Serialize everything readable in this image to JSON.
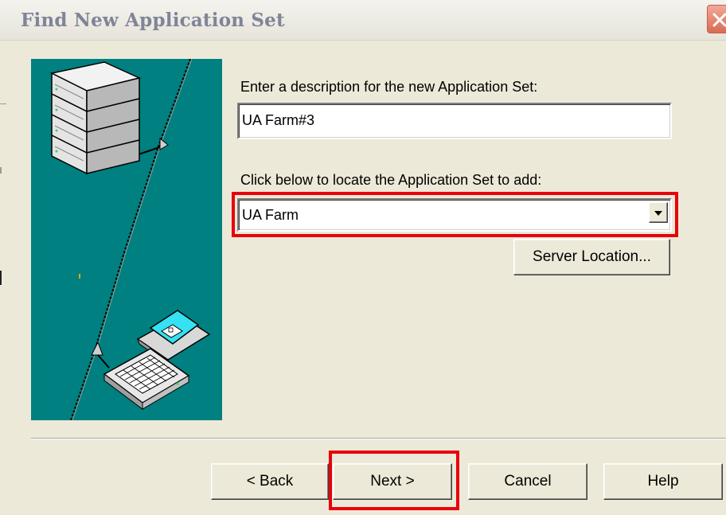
{
  "window": {
    "title": "Find New Application Set"
  },
  "form": {
    "description_label": "Enter a description for the new Application Set:",
    "description_value": "UA Farm#3",
    "locate_label": "Click below to locate the Application Set to add:",
    "appset_selected": "UA Farm",
    "server_location_button": "Server Location..."
  },
  "buttons": {
    "back": "< Back",
    "next": "Next >",
    "cancel": "Cancel",
    "help": "Help"
  },
  "icons": {
    "close": "close-icon",
    "illustration": [
      "server-stack-icon",
      "laptop-icon",
      "network-cable"
    ],
    "dropdown": "chevron-down-icon"
  },
  "colors": {
    "dialog_background": "#ece9d8",
    "illustration_background": "#008080",
    "highlight": "#e8000b",
    "title_text": "#7f8498"
  },
  "annotations": {
    "highlighted": [
      "appset-combobox",
      "next-button"
    ]
  }
}
